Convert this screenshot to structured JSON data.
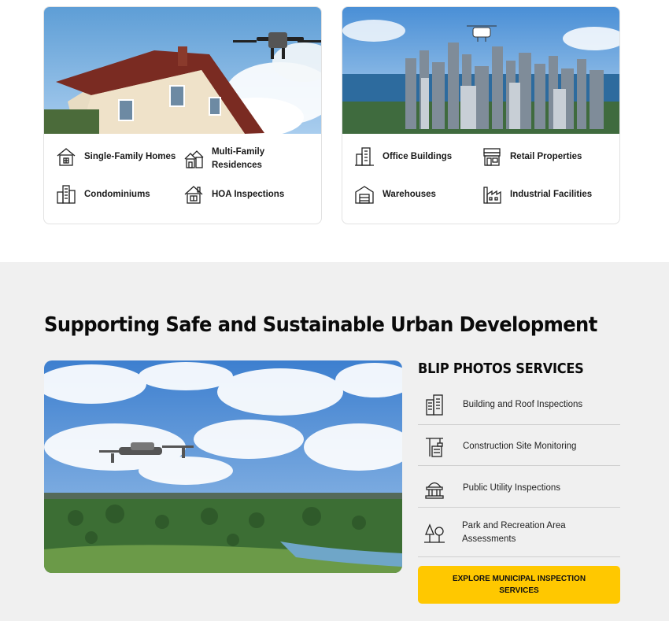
{
  "residential_card": {
    "image_alt": "Drone flying near a residential house roof",
    "items": [
      {
        "label": "Single-Family Homes",
        "icon": "house-icon"
      },
      {
        "label": "Multi-Family Residences",
        "icon": "multi-family-icon"
      },
      {
        "label": "Condominiums",
        "icon": "condo-icon"
      },
      {
        "label": "HOA Inspections",
        "icon": "hoa-house-icon"
      }
    ]
  },
  "commercial_card": {
    "image_alt": "Drone flying over a city skyline",
    "items": [
      {
        "label": "Office Buildings",
        "icon": "office-building-icon"
      },
      {
        "label": "Retail Properties",
        "icon": "retail-store-icon"
      },
      {
        "label": "Warehouses",
        "icon": "warehouse-icon"
      },
      {
        "label": "Industrial Facilities",
        "icon": "factory-icon"
      }
    ]
  },
  "section": {
    "title": "Supporting Safe and Sustainable Urban Development",
    "image_alt": "Drone flying over a green park landscape",
    "services_title": "BLIP PHOTOS SERVICES",
    "services": [
      {
        "label": "Building and Roof Inspections",
        "icon": "buildings-icon"
      },
      {
        "label": "Construction Site Monitoring",
        "icon": "crane-icon"
      },
      {
        "label": "Public Utility Inspections",
        "icon": "utility-dome-icon"
      },
      {
        "label": "Park and Recreation Area Assessments",
        "icon": "park-trees-icon"
      }
    ],
    "cta_label": "EXPLORE MUNICIPAL INSPECTION SERVICES",
    "cta_color": "#ffc800"
  },
  "colors": {
    "section_bg": "#f0f0f0",
    "accent": "#ffc800"
  }
}
